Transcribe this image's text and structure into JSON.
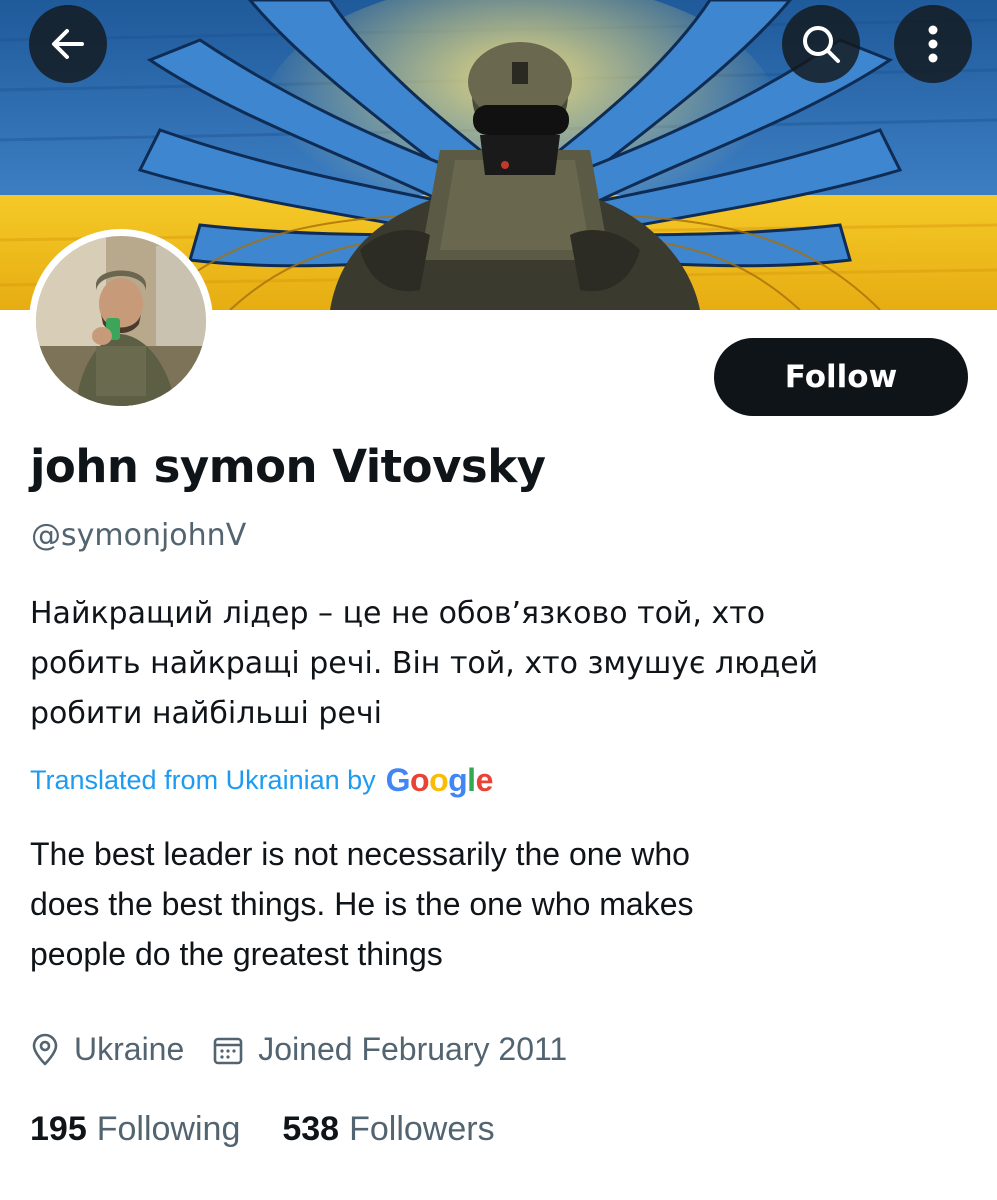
{
  "header": {
    "back_icon": "arrow-left-icon",
    "search_icon": "search-icon",
    "more_icon": "more-vertical-icon"
  },
  "profile": {
    "display_name": "john symon Vitovsky",
    "handle": "@symonjohnV",
    "follow_label": "Follow",
    "bio_lines": [
      "Найкращий лідер – це не обов’язково той, хто",
      "робить найкращі речі. Він той, хто змушує людей",
      "робити найбільші речі"
    ],
    "translation": {
      "label": "Translated from Ukrainian by",
      "google": [
        "G",
        "o",
        "o",
        "g",
        "l",
        "e"
      ],
      "text_lines": [
        "The best leader is not necessarily the one who",
        "does the best things. He is the one who makes",
        "people do the greatest things"
      ]
    },
    "location": "Ukraine",
    "joined": "Joined February 2011",
    "following_count": "195",
    "following_label": "Following",
    "followers_count": "538",
    "followers_label": "Followers"
  },
  "colors": {
    "accent": "#1d9bf0",
    "text": "#0f1419",
    "secondary": "#536471",
    "flag_blue": "#2f6fb5",
    "flag_yellow": "#f2c318",
    "google": [
      "#4285F4",
      "#EA4335",
      "#FBBC05",
      "#4285F4",
      "#34A853",
      "#EA4335"
    ]
  }
}
